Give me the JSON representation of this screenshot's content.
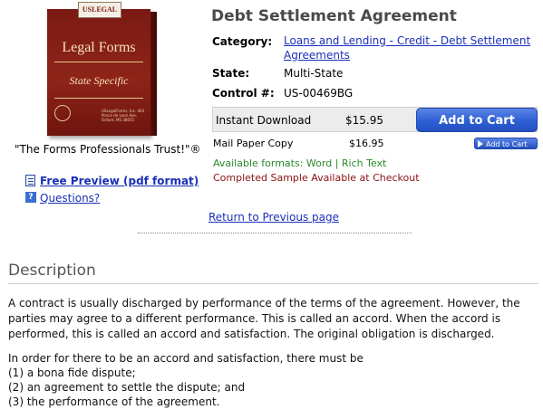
{
  "product_image": {
    "brand": "USLEGAL",
    "title": "Legal Forms",
    "subtitle": "State Specific",
    "fine_print": "USLegalForms, Inc. 404 Ponce de Leon Ave, Oxford, MS 38655"
  },
  "tagline": "\"The Forms Professionals Trust!\"®",
  "product": {
    "title": "Debt Settlement Agreement",
    "category_label": "Category:",
    "category_value_line1": "Loans and Lending - Credit - Debt Settlement",
    "category_value_line2": "Agreements",
    "state_label": "State:",
    "state_value": "Multi-State",
    "control_label": "Control #:",
    "control_value": "US-00469BG"
  },
  "purchase": {
    "instant_label": "Instant Download",
    "instant_price": "$15.95",
    "add_to_cart": "Add to Cart",
    "mail_label": "Mail Paper Copy",
    "mail_price": "$16.95",
    "add_to_cart_small": "Add to Cart",
    "formats": "Available formats: Word | Rich Text",
    "sample": "Completed Sample Available at Checkout"
  },
  "links": {
    "preview": "Free Preview (pdf format)",
    "questions": "Questions?",
    "return": "Return to Previous page"
  },
  "description": {
    "heading": "Description",
    "p1_l1": "A contract is usually discharged by performance of the terms of the agreement. However, the",
    "p1_l2": "parties may agree to a different performance. This is called an accord. When the accord is",
    "p1_l3": "performed, this is called an accord and satisfaction. The original obligation is discharged.",
    "p2_l1": "In order for there to be an accord and satisfaction, there must be",
    "p2_l2": "(1) a bona fide dispute;",
    "p2_l3": "(2) an agreement to settle the dispute; and",
    "p2_l4": "(3) the performance of the agreement."
  }
}
